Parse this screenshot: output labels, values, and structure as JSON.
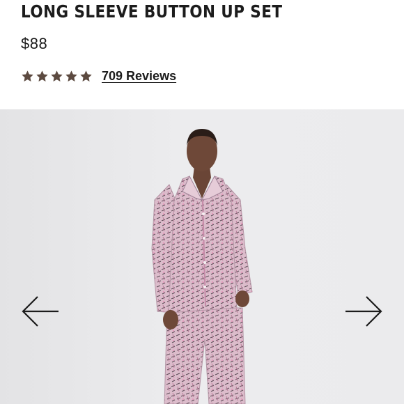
{
  "product": {
    "title": "LONG SLEEVE BUTTON UP SET",
    "price": "$88",
    "rating": 5,
    "rating_max": 5,
    "reviews_label": "709 Reviews"
  },
  "gallery": {
    "prev_icon": "arrow-left-icon",
    "next_icon": "arrow-right-icon"
  },
  "colors": {
    "star": "#5c4a40",
    "text": "#1c1c1c",
    "pajama_pink": "#d9b3c4",
    "background": "#ebebed"
  }
}
